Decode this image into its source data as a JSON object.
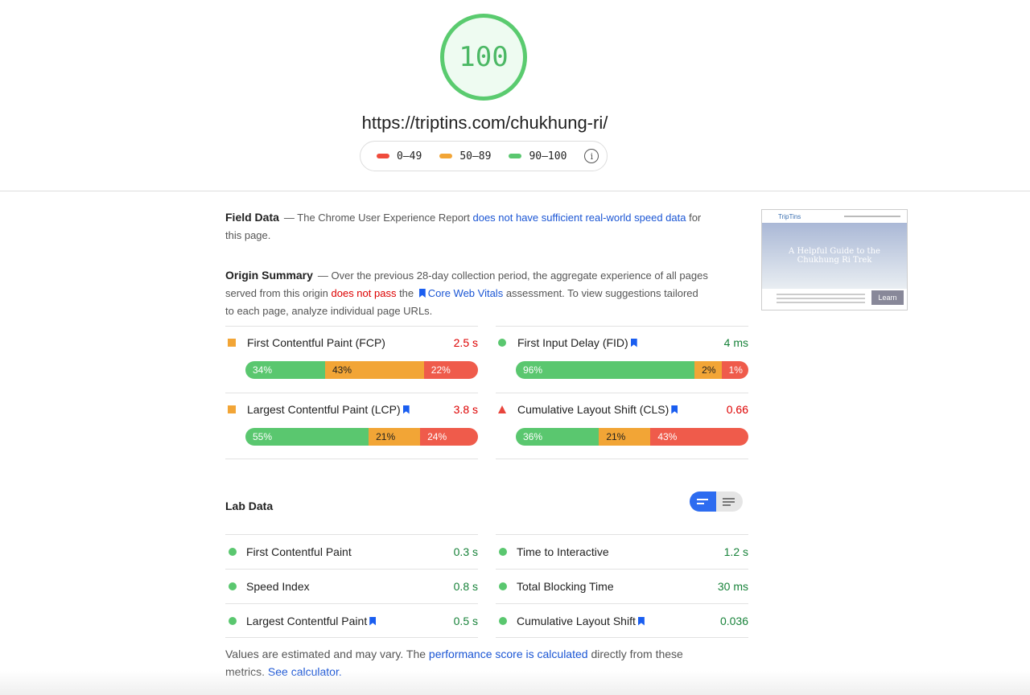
{
  "score": {
    "value": "100",
    "color": "#5acb6f"
  },
  "url": "https://triptins.com/chukhung-ri/",
  "legend": [
    {
      "label": "0–49",
      "color": "#ef4b3c"
    },
    {
      "label": "50–89",
      "color": "#f2a536"
    },
    {
      "label": "90–100",
      "color": "#5ac76f"
    }
  ],
  "field": {
    "title": "Field Data",
    "pre": "— The Chrome User Experience Report ",
    "link": "does not have sufficient real-world speed data",
    "post": " for this page."
  },
  "origin": {
    "title": "Origin Summary",
    "pre": "— Over the previous 28-day collection period, the aggregate experience of all pages served from this origin ",
    "fail": "does not pass",
    "mid": " the ",
    "link": "Core Web Vitals",
    "post": " assessment. To view suggestions tailored to each page, analyze individual page URLs."
  },
  "field_metrics": [
    {
      "name": "First Contentful Paint (FCP)",
      "value": "2.5 s",
      "status": "average",
      "bookmark": false,
      "dist": [
        34,
        43,
        22
      ],
      "labels": [
        "34%",
        "43%",
        "22%"
      ]
    },
    {
      "name": "First Input Delay (FID)",
      "value": "4 ms",
      "status": "good",
      "bookmark": true,
      "dist": [
        96,
        2,
        1
      ],
      "labels": [
        "96%",
        "2%",
        "1%"
      ]
    },
    {
      "name": "Largest Contentful Paint (LCP)",
      "value": "3.8 s",
      "status": "average",
      "bookmark": true,
      "dist": [
        55,
        21,
        24
      ],
      "labels": [
        "55%",
        "21%",
        "24%"
      ]
    },
    {
      "name": "Cumulative Layout Shift (CLS)",
      "value": "0.66",
      "status": "poor",
      "bookmark": true,
      "dist": [
        36,
        21,
        43
      ],
      "labels": [
        "36%",
        "21%",
        "43%"
      ]
    }
  ],
  "lab": {
    "title": "Lab Data",
    "metrics": [
      {
        "name": "First Contentful Paint",
        "value": "0.3 s",
        "bookmark": false
      },
      {
        "name": "Time to Interactive",
        "value": "1.2 s",
        "bookmark": false
      },
      {
        "name": "Speed Index",
        "value": "0.8 s",
        "bookmark": false
      },
      {
        "name": "Total Blocking Time",
        "value": "30 ms",
        "bookmark": false
      },
      {
        "name": "Largest Contentful Paint",
        "value": "0.5 s",
        "bookmark": true
      },
      {
        "name": "Cumulative Layout Shift",
        "value": "0.036",
        "bookmark": true
      }
    ]
  },
  "footer": {
    "pre": "Values are estimated and may vary. The ",
    "link1": "performance score is calculated",
    "mid": " directly from these metrics. ",
    "link2": "See calculator."
  },
  "thumbnail": {
    "brand": "TripTins",
    "heading": "A Helpful Guide to the Chukhung Ri Trek",
    "button": "Learn"
  }
}
